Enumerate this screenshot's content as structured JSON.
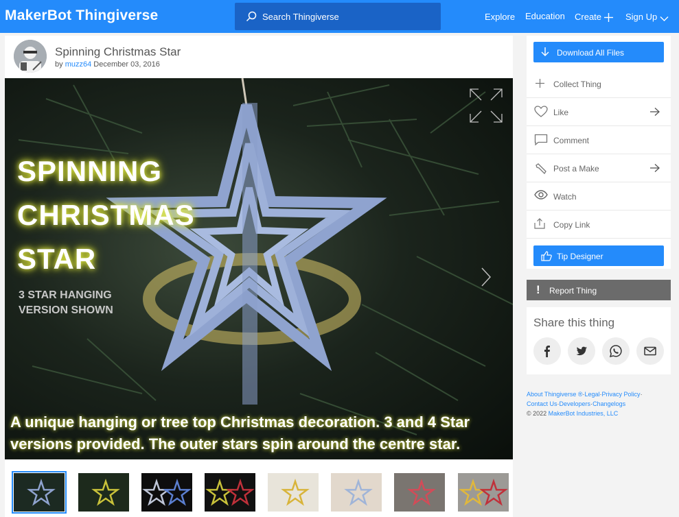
{
  "header": {
    "logo_brand": "MakerBot",
    "logo_product": "Thingiverse",
    "search_placeholder": "Search Thingiverse",
    "nav": [
      "Explore",
      "Education",
      "Create",
      "Sign Up"
    ]
  },
  "thing": {
    "title": "Spinning Christmas Star",
    "by_prefix": "by",
    "author": "muzz64",
    "date": "December 03, 2016",
    "hero": {
      "title_lines": [
        "SPINNING",
        "CHRISTMAS",
        "STAR"
      ],
      "subtitle_lines": [
        "3 STAR HANGING",
        "VERSION SHOWN"
      ],
      "caption": "A unique hanging or tree top Christmas decoration.  3 and 4 Star versions provided.  The outer stars spin around the centre star."
    },
    "thumbnail_count": 8,
    "selected_thumbnail": 1
  },
  "actions": {
    "download": "Download All Files",
    "collect": "Collect Thing",
    "like": "Like",
    "comment": "Comment",
    "post_make": "Post a Make",
    "watch": "Watch",
    "copy_link": "Copy Link",
    "tip": "Tip Designer"
  },
  "report": "Report Thing",
  "share": {
    "heading": "Share this thing",
    "services": [
      "facebook-icon",
      "twitter-icon",
      "whatsapp-icon",
      "email-icon"
    ]
  },
  "footer": {
    "about": "About Thingiverse ®",
    "legal": "Legal",
    "privacy": "Privacy Policy",
    "contact": "Contact Us",
    "developers": "Developers",
    "changelogs": "Changelogs",
    "copyright_year": "©  2022",
    "company": "MakerBot Industries, LLC"
  },
  "colors": {
    "brand_blue": "#248bfb",
    "search_bg": "#1a63c6",
    "report_bg": "#6b6b6b"
  }
}
